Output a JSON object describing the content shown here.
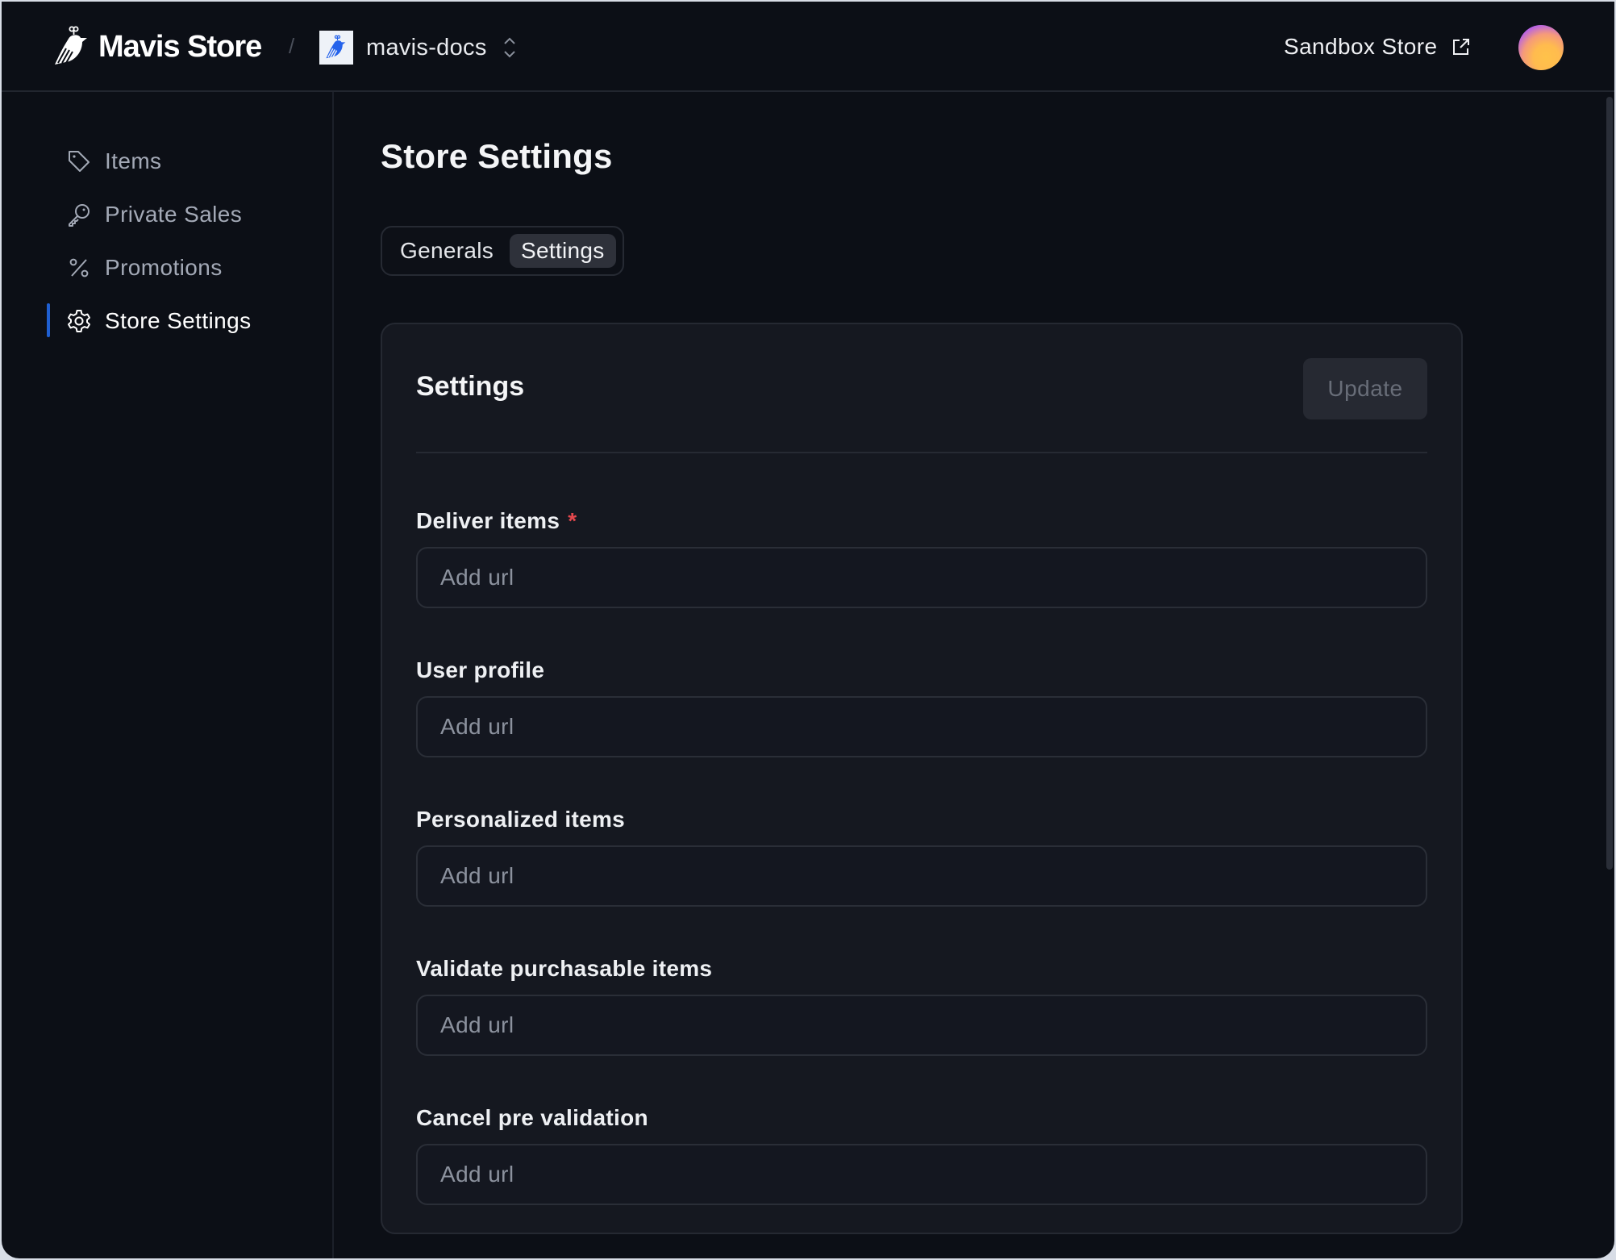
{
  "header": {
    "brand_name": "Mavis Store",
    "breadcrumb_separator": "/",
    "project_name": "mavis-docs",
    "sandbox_label": "Sandbox Store",
    "icons": {
      "brand": "bird-logo-icon",
      "project": "bird-logo-icon",
      "switcher": "chevron-up-down-icon",
      "external": "external-link-icon"
    }
  },
  "sidebar": {
    "items": [
      {
        "label": "Items",
        "icon": "tag-icon",
        "active": false
      },
      {
        "label": "Private Sales",
        "icon": "key-icon",
        "active": false
      },
      {
        "label": "Promotions",
        "icon": "percent-icon",
        "active": false
      },
      {
        "label": "Store Settings",
        "icon": "gear-icon",
        "active": true
      }
    ]
  },
  "main": {
    "title": "Store Settings",
    "tabs": [
      {
        "label": "Generals",
        "active": false
      },
      {
        "label": "Settings",
        "active": true
      }
    ],
    "card": {
      "title": "Settings",
      "update_label": "Update",
      "fields": [
        {
          "label": "Deliver items",
          "required": true,
          "required_mark": "*",
          "placeholder": "Add url",
          "value": ""
        },
        {
          "label": "User profile",
          "required": false,
          "placeholder": "Add url",
          "value": ""
        },
        {
          "label": "Personalized items",
          "required": false,
          "placeholder": "Add url",
          "value": ""
        },
        {
          "label": "Validate purchasable items",
          "required": false,
          "placeholder": "Add url",
          "value": ""
        },
        {
          "label": "Cancel pre validation",
          "required": false,
          "placeholder": "Add url",
          "value": ""
        }
      ]
    }
  },
  "colors": {
    "background": "#0c0f16",
    "card": "#151820",
    "accent": "#1f5fd1",
    "required": "#e5484d",
    "logo_blue": "#2563eb"
  }
}
